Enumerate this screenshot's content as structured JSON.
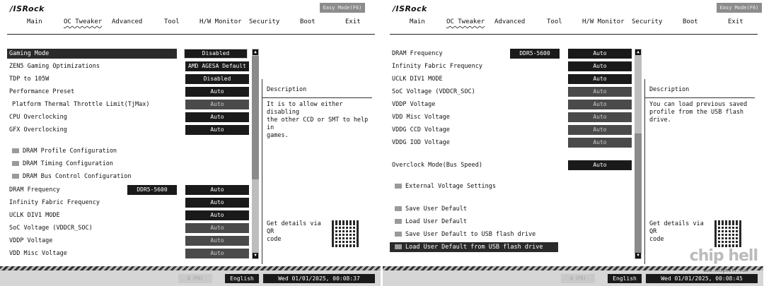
{
  "left": {
    "brand": "/ISRock",
    "easy_mode": "Easy Mode(F6)",
    "nav": [
      "Main",
      "OC Tweaker",
      "Advanced",
      "Tool",
      "H/W Monitor",
      "Security",
      "Boot",
      "Exit"
    ],
    "rows": [
      {
        "label": "Gaming Mode",
        "value": "Disabled"
      },
      {
        "label": "ZEN5 Gaming Optimizations",
        "value": "AMD AGESA Default"
      },
      {
        "label": "TDP to 105W",
        "value": "Disabled"
      },
      {
        "label": "Performance Preset",
        "value": "Auto"
      },
      {
        "label": "Platform Thermal Throttle Limit(TjMax)",
        "value": "Auto"
      },
      {
        "label": "CPU Overclocking",
        "value": "Auto"
      },
      {
        "label": "GFX Overclocking",
        "value": "Auto"
      },
      {
        "label": "DRAM Profile Configuration"
      },
      {
        "label": "DRAM Timing Configuration"
      },
      {
        "label": "DRAM Bus Control Configuration"
      },
      {
        "label": "DRAM Frequency",
        "chip": "DDR5-5600",
        "value": "Auto"
      },
      {
        "label": "Infinity Fabric Frequency",
        "value": "Auto"
      },
      {
        "label": "UCLK DIV1 MODE",
        "value": "Auto"
      },
      {
        "label": "SoC Voltage (VDDCR_SOC)",
        "value": "Auto"
      },
      {
        "label": "VDDP Voltage",
        "value": "Auto"
      },
      {
        "label": "VDD Misc Voltage",
        "value": "Auto"
      }
    ],
    "description_title": "Description",
    "description_text": [
      "It is to allow either disabling",
      "the other CCD or SMT to help in",
      "games."
    ],
    "qr_label": [
      "Get details via QR",
      "code"
    ],
    "search_label": "Q (F5)",
    "language": "English",
    "datetime": "Wed 01/01/2025, 00:08:37"
  },
  "right": {
    "brand": "/ISRock",
    "easy_mode": "Easy Mode(F6)",
    "nav": [
      "Main",
      "OC Tweaker",
      "Advanced",
      "Tool",
      "H/W Monitor",
      "Security",
      "Boot",
      "Exit"
    ],
    "rows": [
      {
        "label": "DRAM Frequency",
        "chip": "DDR5-5600",
        "value": "Auto"
      },
      {
        "label": "Infinity Fabric Frequency",
        "value": "Auto"
      },
      {
        "label": "UCLK DIV1 MODE",
        "value": "Auto"
      },
      {
        "label": "SoC Voltage (VDDCR_SOC)",
        "value": "Auto"
      },
      {
        "label": "VDDP Voltage",
        "value": "Auto"
      },
      {
        "label": "VDD Misc Voltage",
        "value": "Auto"
      },
      {
        "label": "VDDG CCD Voltage",
        "value": "Auto"
      },
      {
        "label": "VDDG IOD Voltage",
        "value": "Auto"
      },
      {
        "label": "Overclock Mode(Bus Speed)",
        "value": "Auto"
      },
      {
        "label": "External Voltage Settings"
      },
      {
        "label": "Save User Default"
      },
      {
        "label": "Load User Default"
      },
      {
        "label": "Save User Default to USB flash drive"
      },
      {
        "label": "Load User Default from USB flash drive"
      }
    ],
    "description_title": "Description",
    "description_text": [
      "You can load previous saved",
      "profile from the USB flash drive."
    ],
    "qr_label": [
      "Get details via QR",
      "code"
    ],
    "search_label": "Q (F5)",
    "language": "English",
    "datetime": "Wed 01/01/2025, 00:08:45",
    "watermark": "chip hell",
    "watermark_url": "www.chiphell.com"
  },
  "colors": {
    "selected_row": "#2a2a2a",
    "value_box": "#1a1a1a",
    "value_dim": "#4a4a4a",
    "footer": "#d6d6d6"
  }
}
